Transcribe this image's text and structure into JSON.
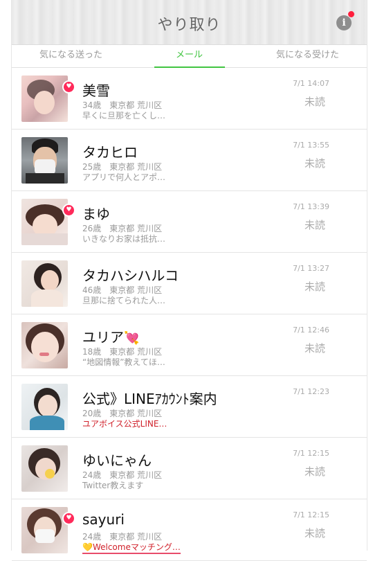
{
  "header": {
    "title": "やり取り",
    "info_label": "i"
  },
  "tabs": [
    {
      "label": "気になる送った"
    },
    {
      "label": "メール"
    },
    {
      "label": "気になる受けた"
    }
  ],
  "messages": [
    {
      "name": "美雪",
      "meta": "34歳　東京都 荒川区",
      "preview": "早くに旦那を亡くし…",
      "time": "7/1 14:07",
      "status": "未読",
      "favorited": true
    },
    {
      "name": "タカヒロ",
      "meta": "25歳　東京都 荒川区",
      "preview": "アプリで何人とアポ…",
      "time": "7/1 13:55",
      "status": "未読",
      "favorited": false
    },
    {
      "name": "まゆ",
      "meta": "26歳　東京都 荒川区",
      "preview": "いきなりお家は抵抗…",
      "time": "7/1 13:39",
      "status": "未読",
      "favorited": true
    },
    {
      "name": "タカハシハルコ",
      "meta": "46歳　東京都 荒川区",
      "preview": "旦那に捨てられた人…",
      "time": "7/1 13:27",
      "status": "未読",
      "favorited": false
    },
    {
      "name": "ユリア",
      "name_emoji": "💘",
      "meta": "18歳　東京都 荒川区",
      "preview": "“地図情報”教えてほ…",
      "time": "7/1 12:46",
      "status": "未読",
      "favorited": false
    },
    {
      "name": "公式》LINEｱｶｳﾝﾄ案内",
      "meta": "20歳　東京都 荒川区",
      "preview": "ユアボイス公式LINE…",
      "time": "7/1 12:23",
      "status": "",
      "favorited": false
    },
    {
      "name": "ゆいにゃん",
      "meta": "24歳　東京都 荒川区",
      "preview": "Twitter教えます",
      "time": "7/1 12:15",
      "status": "未読",
      "favorited": false
    },
    {
      "name": "sayuri",
      "meta": "24歳　東京都 荒川区",
      "preview": "💛Welcomeマッチング…",
      "time": "7/1 12:15",
      "status": "未読",
      "favorited": true
    }
  ],
  "colors": {
    "accent": "#41c441",
    "heart": "#ff2a5a",
    "alert_text": "#d0202a"
  }
}
